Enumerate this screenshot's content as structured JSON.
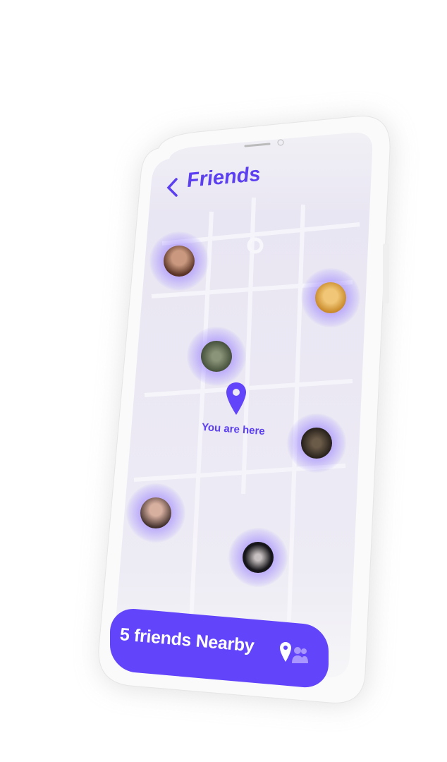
{
  "header": {
    "title": "Friends",
    "back_icon": "chevron-left-icon"
  },
  "map": {
    "you_are_here": "You are here",
    "friends": [
      {
        "name": "friend-1",
        "color": "#8a5a44"
      },
      {
        "name": "friend-2",
        "color": "#d89a3a"
      },
      {
        "name": "friend-3",
        "color": "#5b6a4e"
      },
      {
        "name": "friend-4",
        "color": "#3a3028"
      },
      {
        "name": "friend-5",
        "color": "#9a6f62"
      },
      {
        "name": "friend-6",
        "color": "#2c2a30"
      }
    ]
  },
  "footer": {
    "label": "5 friends Nearby",
    "icon": "location-friends-icon"
  },
  "colors": {
    "accent": "#6244fb",
    "map_bg": "#ece9f4"
  }
}
